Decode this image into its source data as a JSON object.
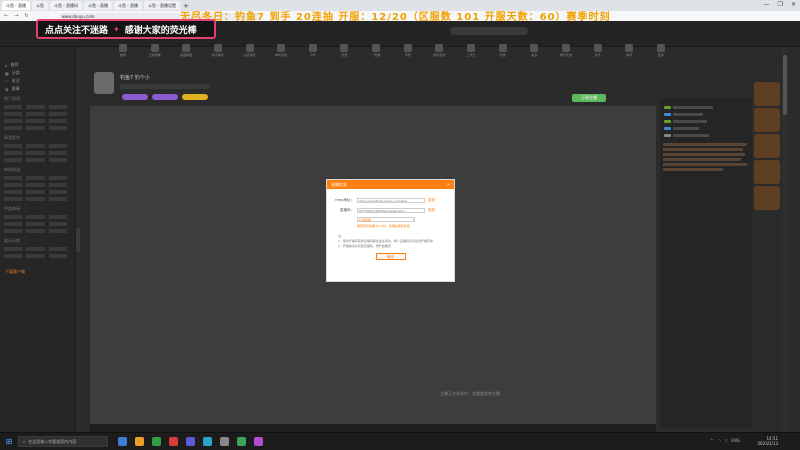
{
  "browser": {
    "tabs": [
      "斗鱼 - 直播",
      "斗鱼",
      "斗鱼 - 直播间",
      "斗鱼 - 直播",
      "斗鱼 - 直播",
      "斗鱼 - 直播设置"
    ],
    "new_tab": "+",
    "url": "www.douyu.com",
    "window_controls": [
      "—",
      "❐",
      "✕"
    ]
  },
  "banner": {
    "left": "点点关注不迷路",
    "star": "✦",
    "right": "感谢大家的荧光棒"
  },
  "marquee": "无尽冬日：钓鱼7 到手 20连抽  开服：12/20（区服数 101 开服天数：60）赛季时刻",
  "categories": [
    "推荐",
    "王者荣耀",
    "英雄联盟",
    "和平精英",
    "主机游戏",
    "单机热游",
    "户外",
    "颜值",
    "一起看",
    "手游",
    "网游竞技",
    "二次元",
    "科技",
    "美食",
    "娱乐天地",
    "音乐",
    "体育",
    "更多"
  ],
  "sidebar": {
    "items": [
      "推荐",
      "分类",
      "关注",
      "赛事"
    ],
    "sections": [
      "热门游戏",
      "网游竞技",
      "单机热游",
      "手游休闲",
      "娱乐天地"
    ],
    "promo": "下载客户端"
  },
  "streamer": {
    "title": "钓鱼7 钓个小",
    "subscribe": "订阅主播",
    "badge_colors": [
      "#8a5bd1",
      "#8a5bd1",
      "#e0b020"
    ]
  },
  "player": {
    "tip": "主播正在休息中，去看看其他主播"
  },
  "dialog": {
    "title": "直播信息",
    "close": "✕",
    "rtmp_label": "rtmp地址：",
    "rtmp_value": "rtmp://sendtc3a.douyu.com/live",
    "copy1": "复制",
    "stream_label": "直播码：",
    "stream_value": "8575389rCRIGSGv?wsSecret=...",
    "copy2": "复制",
    "select_value": "标准线路",
    "warning": "推流码有效期为1小时，到期后重新获取",
    "notes": [
      "注：",
      "1、每次开播获取的直播码都会发生变化，每个直播码仅对当次开播有效",
      "2、开播前请先获取直播码，再开始推流"
    ],
    "ok": "确定"
  },
  "taskbar": {
    "start_icon": "⊞",
    "search_placeholder": "在这里输入你要搜索的内容",
    "app_colors": [
      "#3d7dd8",
      "#e8a02a",
      "#2f9e44",
      "#d83b3b",
      "#5b5bd8",
      "#2aa5c8",
      "#888888",
      "#3ca35a",
      "#b44bd0"
    ],
    "time": "14:51",
    "date": "2023/2/13",
    "lang": "ENG"
  }
}
